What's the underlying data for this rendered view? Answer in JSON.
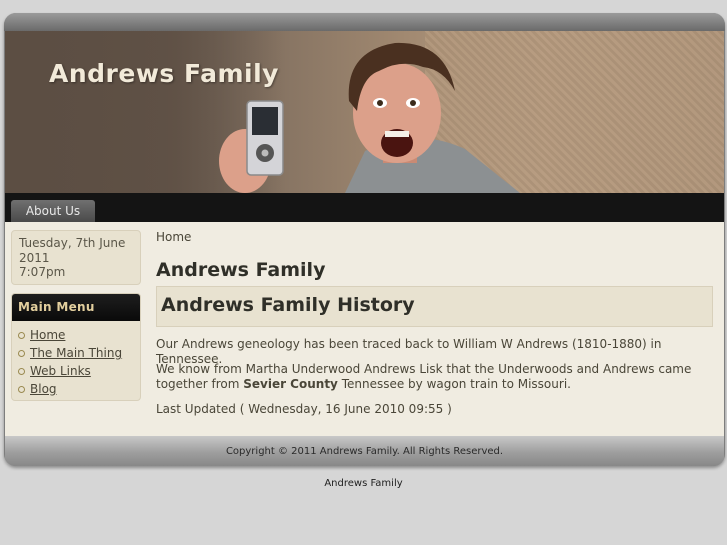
{
  "header": {
    "site_title": "Andrews Family"
  },
  "nav": {
    "tabs": [
      {
        "label": "About Us"
      }
    ]
  },
  "sidebar": {
    "date_line1": "Tuesday, 7th June",
    "date_line2": "2011",
    "time": "7:07pm",
    "menu_title": "Main Menu",
    "menu_items": [
      {
        "label": "Home"
      },
      {
        "label": "The Main Thing"
      },
      {
        "label": "Web Links"
      },
      {
        "label": "Blog"
      }
    ]
  },
  "main": {
    "breadcrumb": "Home",
    "page_title": "Andrews Family",
    "article_title": "Andrews Family History",
    "para1": "Our Andrews geneology has been traced back to William W Andrews (1810-1880) in Tennessee.",
    "para2_before": "We know from Martha Underwood Andrews Lisk that the Underwoods and Andrews came together from ",
    "para2_bold": "Sevier County",
    "para2_after": " Tennessee by wagon train to Missouri.",
    "last_updated": "Last Updated ( Wednesday, 16 June 2010 09:55 )"
  },
  "footer": {
    "copyright": "Copyright © 2011 Andrews Family. All Rights Reserved.",
    "below_text": "Andrews Family"
  },
  "colors": {
    "page_bg": "#d6d6d6",
    "content_bg": "#f0ece1",
    "nav_bg": "#141414",
    "menu_title_text": "#e3cf9e"
  }
}
